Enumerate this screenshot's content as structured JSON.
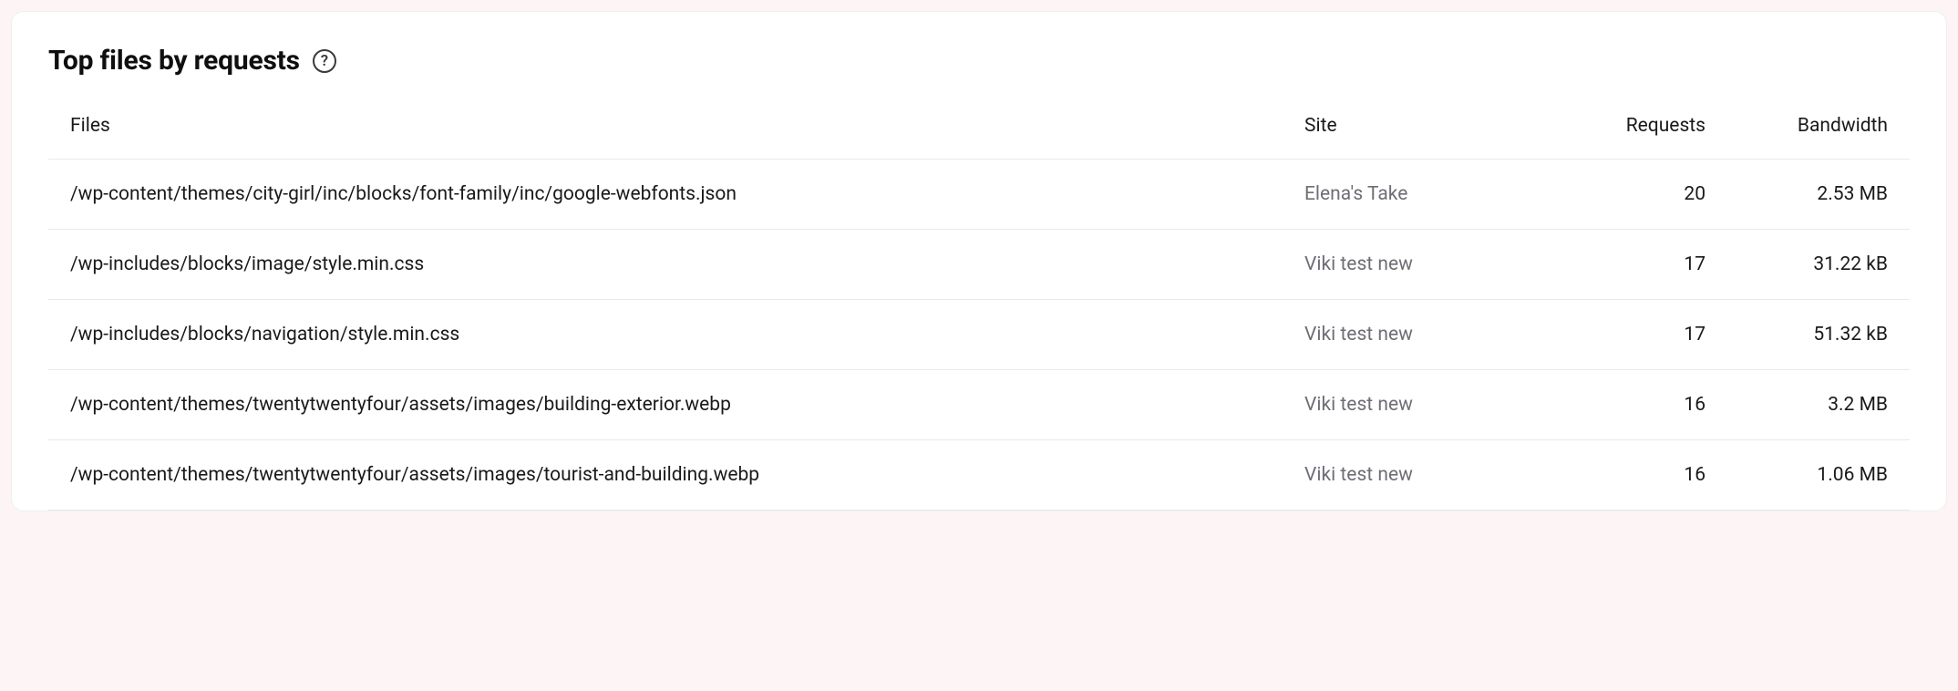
{
  "header": {
    "title": "Top files by requests",
    "help_glyph": "?"
  },
  "table": {
    "columns": {
      "files": "Files",
      "site": "Site",
      "requests": "Requests",
      "bandwidth": "Bandwidth"
    },
    "rows": [
      {
        "file": "/wp-content/themes/city-girl/inc/blocks/font-family/inc/google-webfonts.json",
        "site": "Elena's Take",
        "requests": "20",
        "bandwidth": "2.53 MB"
      },
      {
        "file": "/wp-includes/blocks/image/style.min.css",
        "site": "Viki test new",
        "requests": "17",
        "bandwidth": "31.22 kB"
      },
      {
        "file": "/wp-includes/blocks/navigation/style.min.css",
        "site": "Viki test new",
        "requests": "17",
        "bandwidth": "51.32 kB"
      },
      {
        "file": "/wp-content/themes/twentytwentyfour/assets/images/building-exterior.webp",
        "site": "Viki test new",
        "requests": "16",
        "bandwidth": "3.2 MB"
      },
      {
        "file": "/wp-content/themes/twentytwentyfour/assets/images/tourist-and-building.webp",
        "site": "Viki test new",
        "requests": "16",
        "bandwidth": "1.06 MB"
      }
    ]
  }
}
